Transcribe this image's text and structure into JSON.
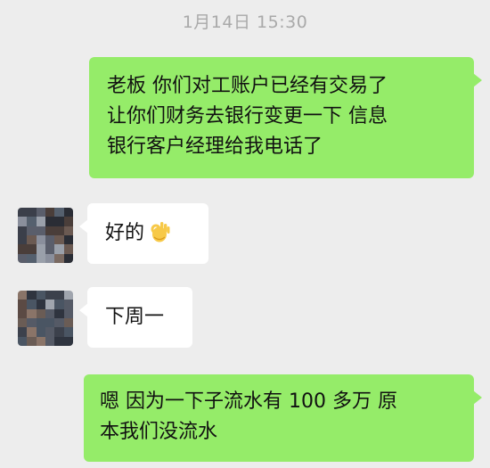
{
  "chat": {
    "timestamp": "1月14日 15:30",
    "messages": [
      {
        "direction": "outgoing",
        "lines": [
          "老板 你们对工账户已经有交易了",
          "让你们财务去银行变更一下 信息",
          "银行客户经理给我电话了"
        ]
      },
      {
        "direction": "incoming",
        "text": "好的",
        "emoji": "ok-hand"
      },
      {
        "direction": "incoming",
        "text": "下周一"
      },
      {
        "direction": "outgoing",
        "lines": [
          "嗯 因为一下子流水有 100 多万  原",
          "本我们没流水"
        ]
      }
    ]
  },
  "colors": {
    "background": "#ededed",
    "outgoing_bubble": "#95ec69",
    "incoming_bubble": "#ffffff",
    "timestamp_text": "#a9a9a9"
  },
  "avatar": {
    "style": "pixelated mosaic (blurred)"
  }
}
